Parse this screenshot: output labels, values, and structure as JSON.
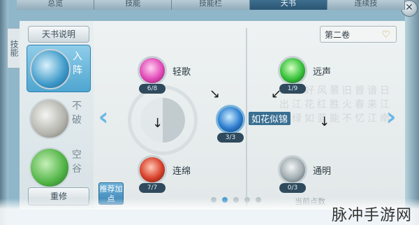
{
  "tabs": [
    "总览",
    "技能",
    "技能栏",
    "天书",
    "连续技"
  ],
  "active_tab": 3,
  "side_label": "技能",
  "left": {
    "tianshu_button": "天书说明",
    "categories": [
      {
        "label": "入阵",
        "icon": "feather-icon",
        "selected": true
      },
      {
        "label": "不破",
        "icon": "cloud-icon",
        "selected": false
      },
      {
        "label": "空谷",
        "icon": "lotus-icon",
        "selected": false
      }
    ],
    "reset_button": "重修"
  },
  "volume": {
    "selected": "第二卷",
    "icon": "gold-dropdown-icon"
  },
  "skills": [
    {
      "name": "轻歌",
      "count": "6/8",
      "icon": "pink-bell-icon"
    },
    {
      "name": "如花似锦",
      "count": "3/3",
      "icon": "blue-flower-icon"
    },
    {
      "name": "连绵",
      "count": "7/7",
      "icon": "red-blade-icon"
    },
    {
      "name": "远声",
      "count": "1/9",
      "icon": "green-bell-icon"
    },
    {
      "name": "通明",
      "count": "0/3",
      "icon": "silver-sword-icon"
    }
  ],
  "recommend_button": "推荐加点",
  "pager": {
    "count": 5,
    "active": 1
  },
  "points_label": "当前点数",
  "scroll_text": "江南好风景旧曾谙日出江花红胜火春来江水绿如蓝能不忆江南",
  "watermark": "脉冲手游网",
  "colors": {
    "active_tab": "#2a5473",
    "selected_category": "#4fa6d0",
    "accent": "#6cb8e4"
  }
}
